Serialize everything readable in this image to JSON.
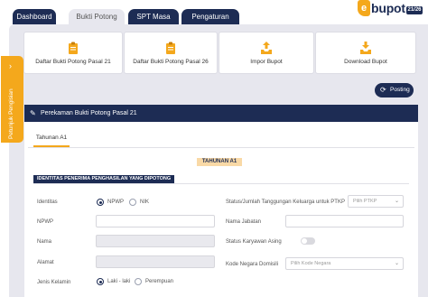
{
  "nav": {
    "tabs": [
      {
        "label": "Dashboard"
      },
      {
        "label": "Bukti Potong"
      },
      {
        "label": "SPT Masa"
      },
      {
        "label": "Pengaturan"
      }
    ]
  },
  "brand": {
    "logo_text": "bupot",
    "logo_letter": "e",
    "version": "21/26"
  },
  "side_tab": {
    "label": "Petunjuk Pengisian"
  },
  "cards": [
    {
      "label": "Daftar Bukti Potong Pasal 21",
      "icon": "clipboard-icon"
    },
    {
      "label": "Daftar Bukti Potong Pasal 26",
      "icon": "clipboard-icon"
    },
    {
      "label": "Impor Bupot",
      "icon": "upload-tray-icon"
    },
    {
      "label": "Download Bupot",
      "icon": "download-tray-icon"
    }
  ],
  "posting_button": {
    "label": "Posting",
    "icon": "refresh-icon"
  },
  "form": {
    "title": "Perekaman Bukti Potong Pasal 21",
    "inner_tab": "Tahunan A1",
    "year_badge": "TAHUNAN A1",
    "section_title": "IDENTITAS PENERIMA PENGHASILAN YANG DIPOTONG",
    "fields": {
      "identitas": {
        "label": "Identitas",
        "options": [
          "NPWP",
          "NIK"
        ],
        "selected": "NPWP"
      },
      "npwp": {
        "label": "NPWP"
      },
      "nama": {
        "label": "Nama"
      },
      "alamat": {
        "label": "Alamat"
      },
      "jenis_kelamin": {
        "label": "Jenis Kelamin",
        "options": [
          "Laki - laki",
          "Perempuan"
        ],
        "selected": "Laki - laki"
      },
      "ptkp": {
        "label": "Status/Jumlah Tanggungan Keluarga untuk PTKP",
        "placeholder": "Pilih PTKP"
      },
      "jabatan": {
        "label": "Nama Jabatan"
      },
      "karyawan_asing": {
        "label": "Status Karyawan Asing",
        "value": false
      },
      "negara": {
        "label": "Kode Negara Domisili",
        "placeholder": "Pilih Kode Negara"
      }
    }
  },
  "colors": {
    "navy": "#1d2c54",
    "accent": "#f4a81c",
    "panel": "#e7e7ee"
  }
}
